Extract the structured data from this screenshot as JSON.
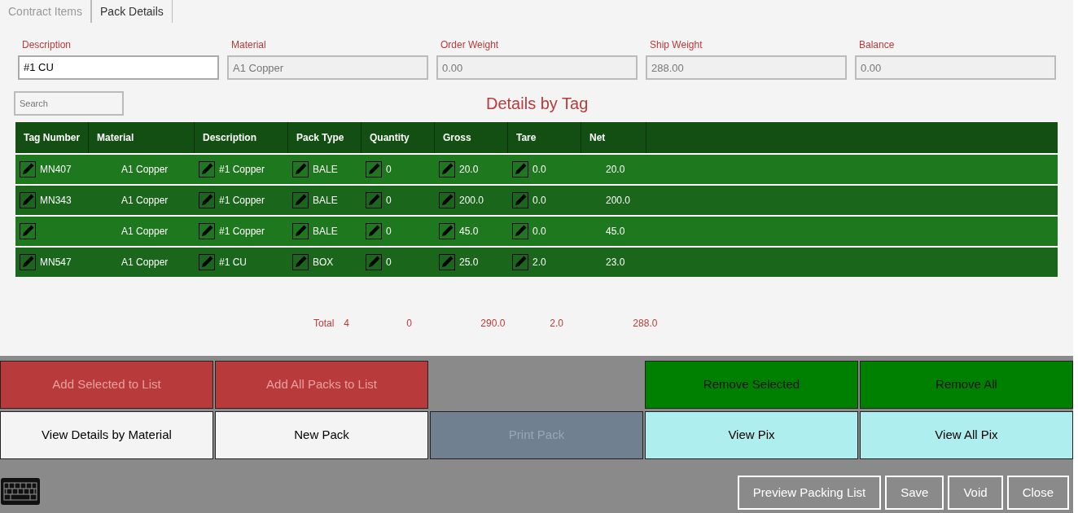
{
  "tabs": [
    {
      "label": "Contract Items",
      "selected": false
    },
    {
      "label": "Pack Details",
      "selected": true
    }
  ],
  "fields": [
    {
      "label": "Description",
      "kind": "select",
      "value": "#1 CU",
      "disabled": false
    },
    {
      "label": "Material",
      "kind": "text",
      "value": "A1 Copper",
      "disabled": true
    },
    {
      "label": "Order Weight",
      "kind": "text",
      "value": "0.00",
      "disabled": true
    },
    {
      "label": "Ship Weight",
      "kind": "text",
      "value": "288.00",
      "disabled": true
    },
    {
      "label": "Balance",
      "kind": "text",
      "value": "0.00",
      "disabled": true
    }
  ],
  "search": {
    "placeholder": "Search"
  },
  "table_title": "Details by Tag",
  "table": {
    "columns": [
      {
        "label": "Tag Number",
        "editable": true
      },
      {
        "label": "Material",
        "editable": false
      },
      {
        "label": "Description",
        "editable": true
      },
      {
        "label": "Pack Type",
        "editable": true
      },
      {
        "label": "Quantity",
        "editable": true
      },
      {
        "label": "Gross",
        "editable": true
      },
      {
        "label": "Tare",
        "editable": true
      },
      {
        "label": "Net",
        "editable": false
      }
    ],
    "rows": [
      [
        "MN407",
        "A1 Copper",
        "#1 Copper",
        "BALE",
        "0",
        "20.0",
        "0.0",
        "20.0"
      ],
      [
        "MN343",
        "A1 Copper",
        "#1 Copper",
        "BALE",
        "0",
        "200.0",
        "0.0",
        "200.0"
      ],
      [
        "",
        "A1 Copper",
        "#1 Copper",
        "BALE",
        "0",
        "45.0",
        "0.0",
        "45.0"
      ],
      [
        "MN547",
        "A1 Copper",
        "#1 CU",
        "BOX",
        "0",
        "25.0",
        "2.0",
        "23.0"
      ]
    ],
    "totals": {
      "label": "Total",
      "count": "4",
      "quantity": "0",
      "gross": "290.0",
      "tare": "2.0",
      "net": "288.0"
    }
  },
  "action_rows": [
    [
      {
        "label": "Add Selected to List",
        "kind": "red",
        "disabled": true
      },
      {
        "label": "Add All Packs to List",
        "kind": "red",
        "disabled": true
      },
      {
        "label": "Remove Selected",
        "kind": "green",
        "disabled": false
      },
      {
        "label": "Remove All",
        "kind": "green",
        "disabled": false
      }
    ],
    [
      {
        "label": "View Details by Material",
        "kind": "white",
        "disabled": false
      },
      {
        "label": "New Pack",
        "kind": "white",
        "disabled": false
      },
      {
        "label": "Print Pack",
        "kind": "slate",
        "disabled": true
      },
      {
        "label": "View Pix",
        "kind": "cyan",
        "disabled": false
      },
      {
        "label": "View All Pix",
        "kind": "cyan",
        "disabled": false
      }
    ]
  ],
  "footer_buttons": [
    "Preview Packing List",
    "Save",
    "Void",
    "Close"
  ]
}
